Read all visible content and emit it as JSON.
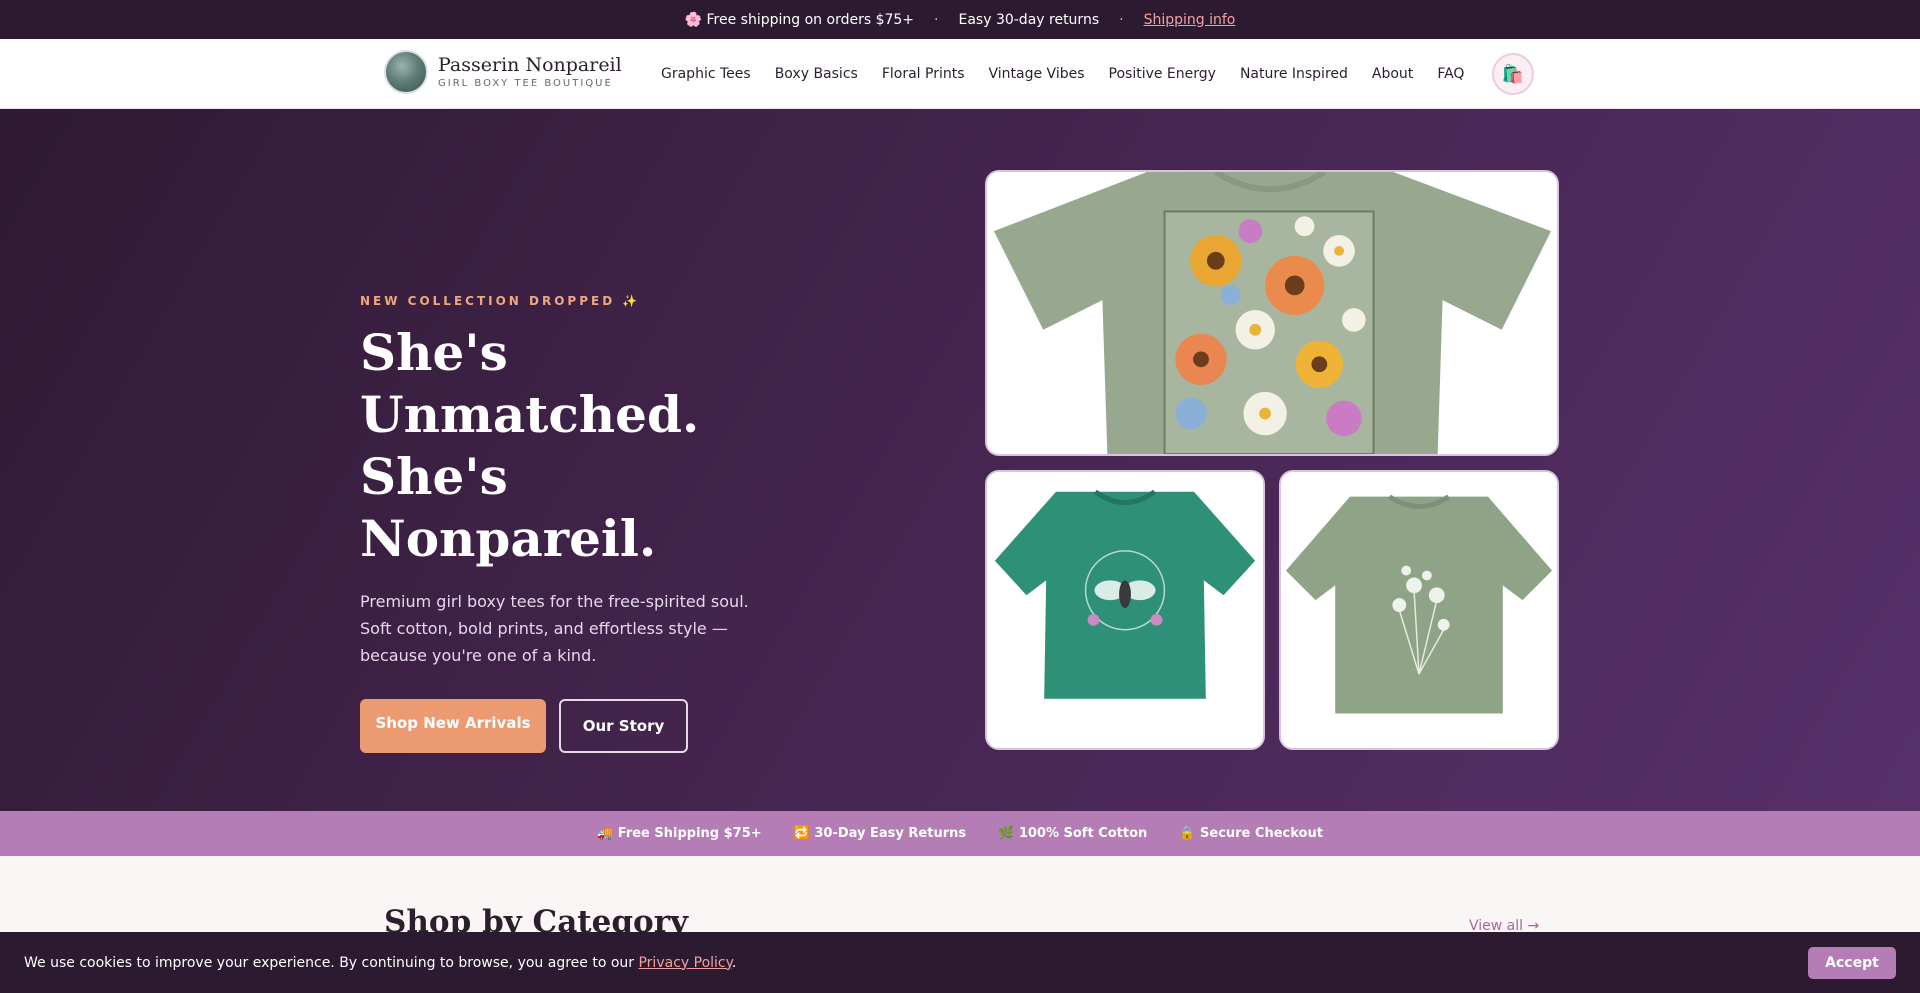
{
  "announcement": {
    "item1": "🌸 Free shipping on orders $75+",
    "sep": "·",
    "item2": "Easy 30-day returns",
    "link": "Shipping info"
  },
  "brand": {
    "name": "Passerin Nonpareil",
    "tagline": "GIRL BOXY TEE BOUTIQUE"
  },
  "nav": {
    "items": [
      "Graphic Tees",
      "Boxy Basics",
      "Floral Prints",
      "Vintage Vibes",
      "Positive Energy",
      "Nature Inspired",
      "About",
      "FAQ"
    ]
  },
  "cart": {
    "icon": "shopping-bag-icon",
    "glyph": "🛍️"
  },
  "hero": {
    "eyebrow": "NEW COLLECTION DROPPED ✨",
    "headline_line1": "She's Unmatched.",
    "headline_line2": "She's Nonpareil.",
    "description": "Premium girl boxy tees for the free-spirited soul. Soft cotton, bold prints, and effortless style — because you're one of a kind.",
    "primary_button": "Shop New Arrivals",
    "secondary_button": "Our Story",
    "tiles": [
      {
        "subject": "sage floral tee",
        "color": "#97a88f"
      },
      {
        "subject": "teal bee tee",
        "color": "#2f9078"
      },
      {
        "subject": "sage wildflower tee",
        "color": "#8fa387"
      }
    ]
  },
  "trust": {
    "items": [
      "🚚 Free Shipping $75+",
      "🔁 30-Day Easy Returns",
      "🌿 100% Soft Cotton",
      "🔒 Secure Checkout"
    ]
  },
  "category": {
    "title": "Shop by Category",
    "view_all": "View all →"
  },
  "cookie": {
    "text": "We use cookies to improve your experience. By continuing to browse, you agree to our ",
    "link": "Privacy Policy",
    "tail": ".",
    "accept": "Accept"
  },
  "colors": {
    "hero_dark": "#2f1a34",
    "hero_light": "#57306a",
    "accent_orange": "#ec9a72",
    "accent_purple": "#b57db5",
    "announce_bg": "#2c1a31"
  }
}
